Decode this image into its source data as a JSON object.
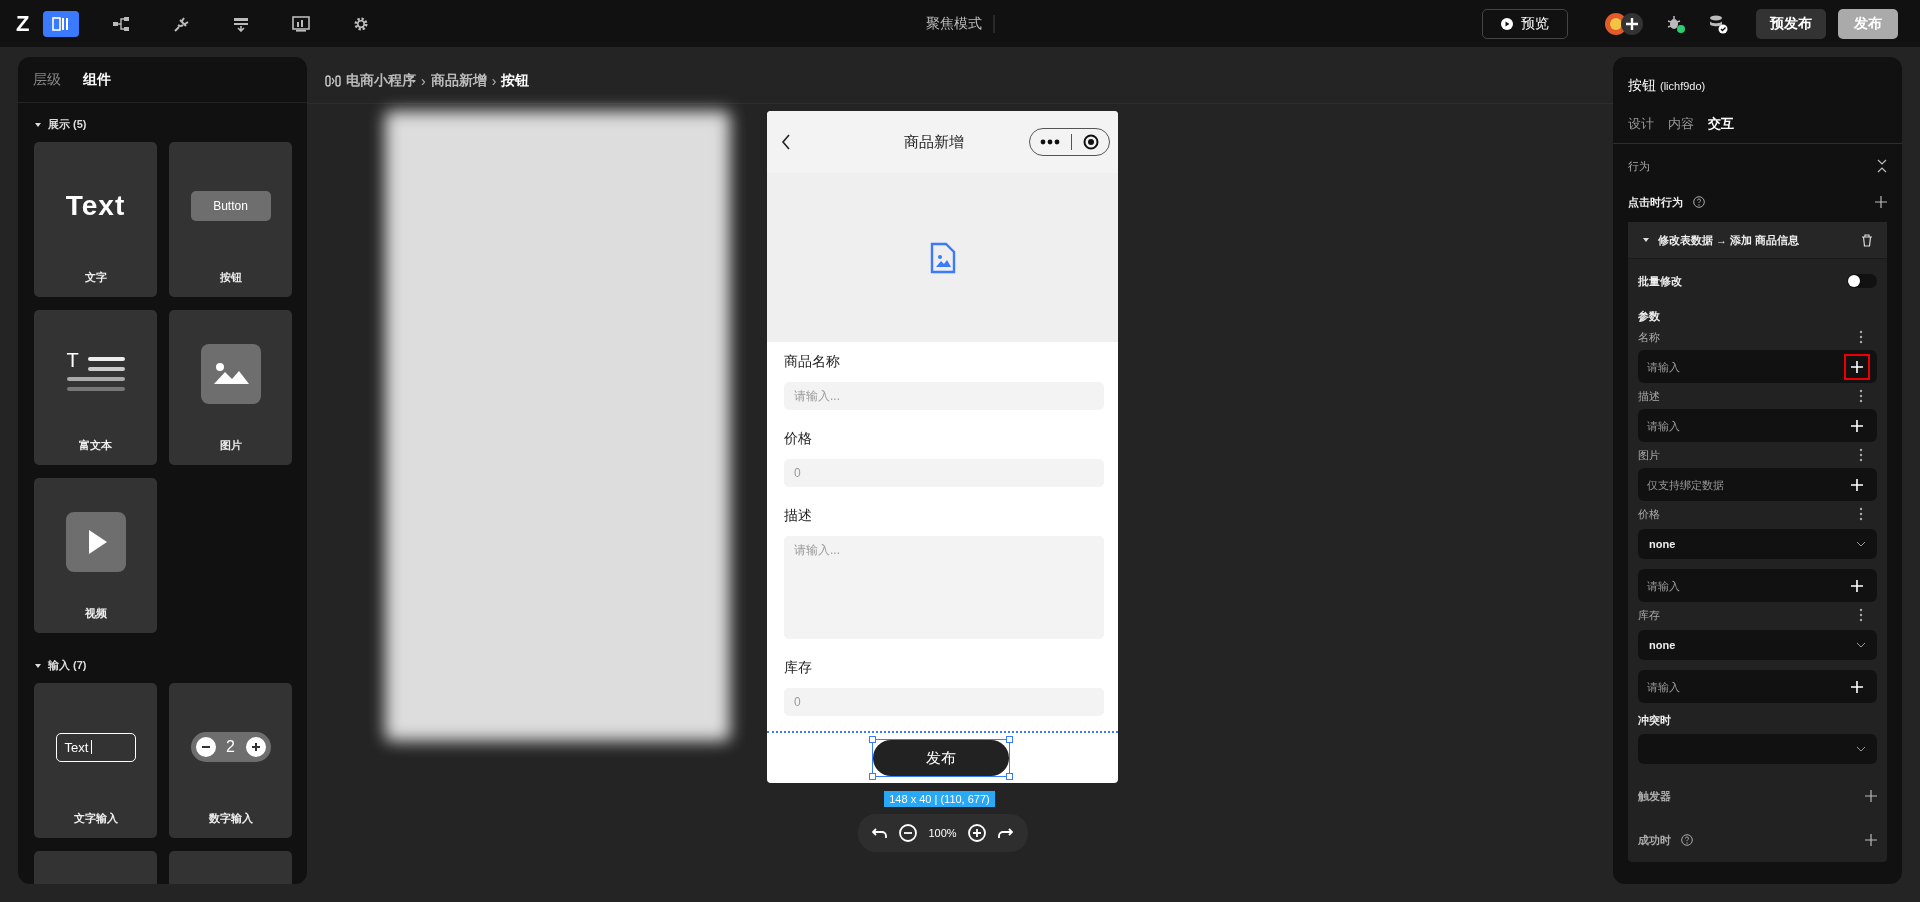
{
  "topbar": {
    "logo": "Z",
    "tools": [
      {
        "kind": "pages",
        "selected": true
      },
      {
        "kind": "tree",
        "selected": false
      },
      {
        "kind": "plug",
        "selected": false
      },
      {
        "kind": "layout",
        "selected": false
      },
      {
        "kind": "chart",
        "selected": false
      },
      {
        "kind": "settings",
        "selected": false
      }
    ],
    "mode": "聚焦模式",
    "preview": "预览",
    "prepublish": "预发布",
    "publish": "发布"
  },
  "left_panel": {
    "tabs": [
      {
        "label": "层级",
        "selected": false
      },
      {
        "label": "组件",
        "selected": true
      }
    ],
    "groups": [
      {
        "title": "展示 (5)",
        "expanded": true,
        "items": [
          {
            "kind": "text",
            "label": "文字",
            "sample": "Text"
          },
          {
            "kind": "button",
            "label": "按钮",
            "sample": "Button"
          },
          {
            "kind": "richtext",
            "label": "富文本",
            "sample": "T"
          },
          {
            "kind": "image",
            "label": "图片"
          },
          {
            "kind": "video",
            "label": "视频"
          }
        ]
      },
      {
        "title": "输入 (7)",
        "expanded": true,
        "items": [
          {
            "kind": "textinput",
            "label": "文字输入",
            "sample": "Text"
          },
          {
            "kind": "number",
            "label": "数字输入",
            "sample": "2"
          },
          {
            "kind": "blank"
          },
          {
            "kind": "blank"
          }
        ]
      }
    ]
  },
  "breadcrumb": {
    "items": [
      "电商小程序",
      "商品新增",
      "按钮"
    ],
    "separator": "›"
  },
  "phone": {
    "title": "商品新增",
    "fields": [
      {
        "kind": "input",
        "label": "商品名称",
        "placeholder": "请输入..."
      },
      {
        "kind": "input",
        "label": "价格",
        "placeholder": "0"
      },
      {
        "kind": "textarea",
        "label": "描述",
        "placeholder": "请输入..."
      },
      {
        "kind": "input",
        "label": "库存",
        "placeholder": "0"
      }
    ],
    "button": "发布",
    "selection_label": "148 x 40 | (110, 677)",
    "zoom": "100%"
  },
  "right_panel": {
    "title": "按钮",
    "id": "(lichf9do)",
    "tabs": [
      {
        "label": "设计",
        "selected": false
      },
      {
        "label": "内容",
        "selected": false
      },
      {
        "label": "交互",
        "selected": true
      }
    ],
    "section": "行为",
    "on_click": "点击时行为",
    "action": {
      "title": "修改表数据 → 添加 商品信息",
      "expanded": true,
      "batch_label": "批量修改",
      "batch_on": false,
      "params_title": "参数",
      "params": [
        {
          "label": "名称",
          "fields": [
            {
              "kind": "input",
              "placeholder": "请输入",
              "highlighted": true
            }
          ]
        },
        {
          "label": "描述",
          "fields": [
            {
              "kind": "input",
              "placeholder": "请输入",
              "highlighted": false
            }
          ]
        },
        {
          "label": "图片",
          "fields": [
            {
              "kind": "input",
              "placeholder": "仅支持绑定数据",
              "highlighted": false
            }
          ]
        },
        {
          "label": "价格",
          "fields": [
            {
              "kind": "select",
              "value": "none"
            },
            {
              "kind": "input",
              "placeholder": "请输入",
              "highlighted": false
            }
          ]
        },
        {
          "label": "库存",
          "fields": [
            {
              "kind": "select",
              "value": "none"
            },
            {
              "kind": "input",
              "placeholder": "请输入",
              "highlighted": false
            }
          ]
        }
      ],
      "conflict_label": "冲突时"
    },
    "trigger": "触发器",
    "on_success": "成功时"
  }
}
